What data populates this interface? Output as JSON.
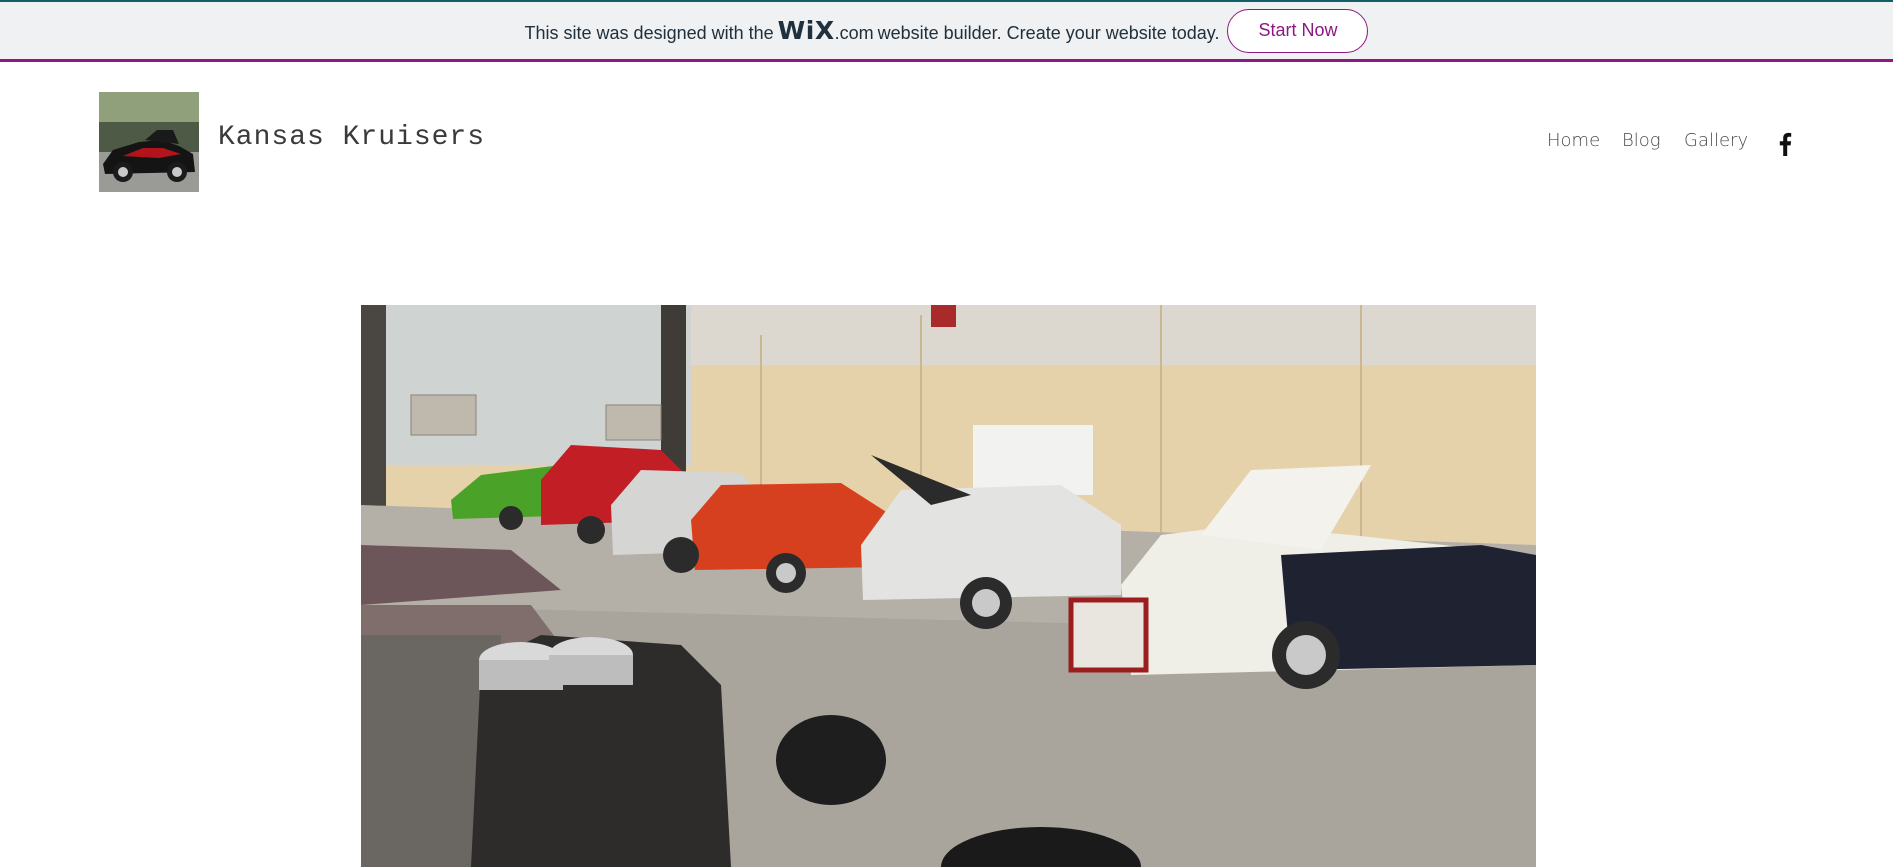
{
  "banner": {
    "text_before": "This site was designed with the",
    "brand_logo": "WiX",
    "brand_domain": ".com",
    "text_after": "website builder. Create your website today.",
    "cta_label": "Start Now"
  },
  "site": {
    "title": "Kansas Kruisers",
    "logo_icon": "hot-rod-car-photo"
  },
  "nav": {
    "items": [
      {
        "label": "Home"
      },
      {
        "label": "Blog"
      },
      {
        "label": "Gallery"
      }
    ],
    "social_icon": "facebook-icon"
  },
  "hero": {
    "image": "car-show-photo"
  },
  "colors": {
    "banner_bg": "#eff1f2",
    "banner_top_border": "#116068",
    "banner_bottom_border": "#8d1783",
    "cta": "#8d1783",
    "nav_text": "#4b4b4b"
  }
}
